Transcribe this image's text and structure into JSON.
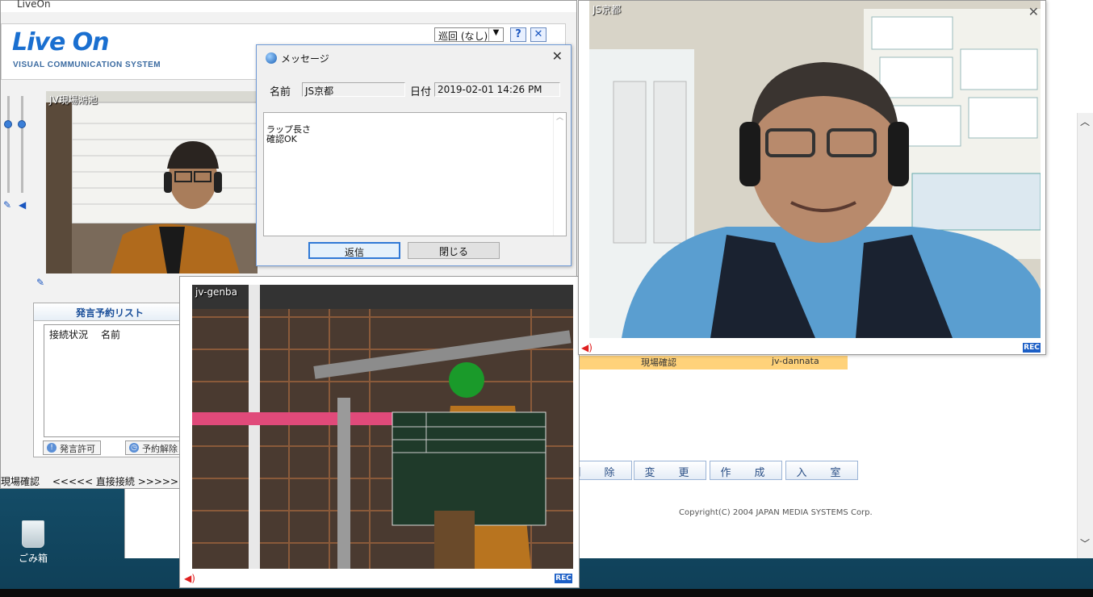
{
  "liveon": {
    "title": "LiveOn",
    "logo": "Live On",
    "logo_sub": "VISUAL COMMUNICATION SYSTEM",
    "patrol_select": "巡回 (なし)",
    "help": "?",
    "close": "✕",
    "local_video_label": "JV現場鴻池",
    "reserve": {
      "title": "発言予約リスト",
      "columns": [
        "接続状況",
        "名前"
      ],
      "permit_button": "発言許可",
      "cancel_button": "予約解除"
    },
    "status_left": "現場確認",
    "status_right": "<<<<< 直接接続 >>>>>"
  },
  "message_dialog": {
    "title": "メッセージ",
    "name_label": "名前",
    "name_value": "JS京都",
    "date_label": "日付",
    "date_value": "2019-02-01 14:26 PM",
    "body": "ラップ長さ\n確認OK",
    "reply_button": "返信",
    "close_button": "閉じる"
  },
  "genba_window": {
    "label": "jv-genba",
    "rec": "REC"
  },
  "kyoto_window": {
    "label": "JS京都",
    "rec": "REC"
  },
  "background_app": {
    "row_col1": "現場確認",
    "row_col2": "jv-dannata",
    "buttons": [
      "削　除",
      "変　更",
      "作　成",
      "入　室"
    ],
    "copyright": "Copyright(C) 2004 JAPAN MEDIA SYSTEMS Corp."
  },
  "desktop": {
    "recycle_bin": "ごみ箱"
  }
}
